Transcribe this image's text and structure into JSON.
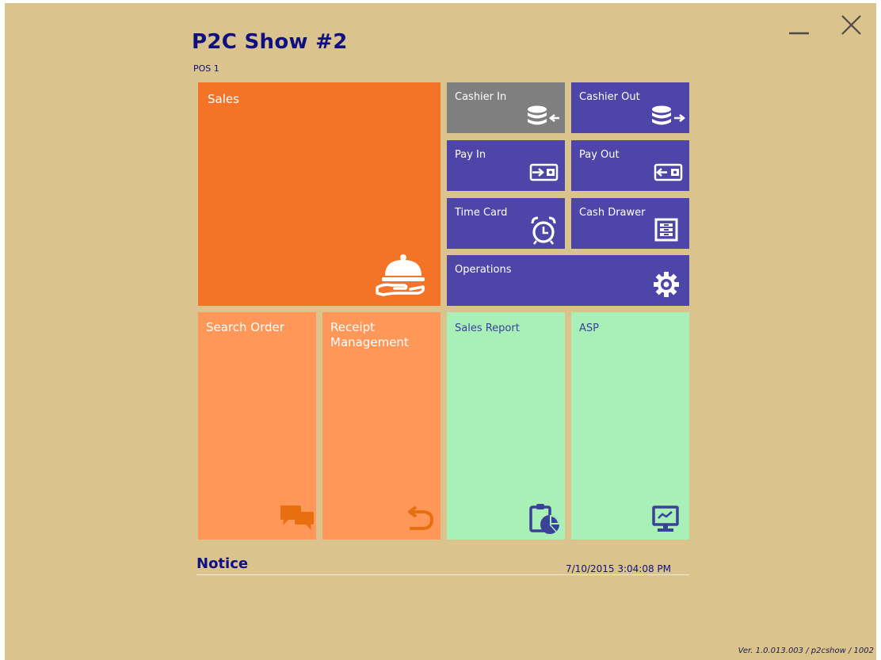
{
  "app": {
    "title": "P2C Show #2",
    "subtitle": "POS 1"
  },
  "window_controls": {
    "minimize_icon": "minimize-icon",
    "close_icon": "close-icon"
  },
  "tiles": {
    "sales": {
      "label": "Sales",
      "icon": "serving-tray-icon",
      "color": "#f37426"
    },
    "cashier_in": {
      "label": "Cashier In",
      "icon": "coins-in-icon",
      "color": "#7f7f7f"
    },
    "cashier_out": {
      "label": "Cashier Out",
      "icon": "coins-out-icon",
      "color": "#4e45a9"
    },
    "pay_in": {
      "label": "Pay In",
      "icon": "wallet-in-icon",
      "color": "#4e45a9"
    },
    "pay_out": {
      "label": "Pay Out",
      "icon": "wallet-out-icon",
      "color": "#4e45a9"
    },
    "time_card": {
      "label": "Time Card",
      "icon": "alarm-clock-icon",
      "color": "#4e45a9"
    },
    "cash_drawer": {
      "label": "Cash Drawer",
      "icon": "cash-drawer-icon",
      "color": "#4e45a9"
    },
    "operations": {
      "label": "Operations",
      "icon": "gear-icon",
      "color": "#4e45a9"
    },
    "search_order": {
      "label": "Search Order",
      "icon": "chat-bubbles-icon",
      "color": "#ff9759"
    },
    "receipt_management": {
      "label": "Receipt\nManagement",
      "icon": "undo-arrow-icon",
      "color": "#ff9759"
    },
    "sales_report": {
      "label": "Sales Report",
      "icon": "clipboard-chart-icon",
      "color": "#a8f0b8"
    },
    "asp": {
      "label": "ASP",
      "icon": "monitor-chart-icon",
      "color": "#a8f0b8"
    }
  },
  "notice": {
    "title": "Notice",
    "datetime": "7/10/2015 3:04:08 PM"
  },
  "footer": {
    "version": "Ver. 1.0.013.003 / p2cshow / 1002"
  }
}
